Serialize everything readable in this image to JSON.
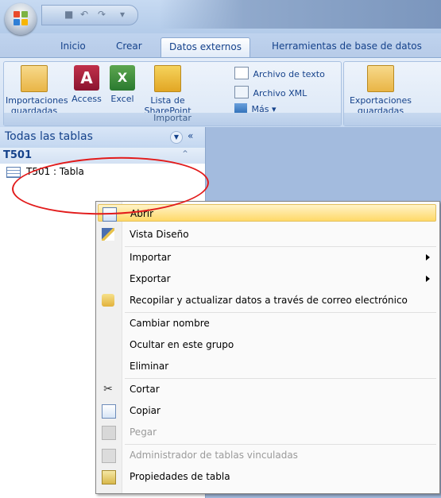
{
  "tabs": [
    {
      "label": "Inicio"
    },
    {
      "label": "Crear"
    },
    {
      "label": "Datos externos"
    },
    {
      "label": "Herramientas de base de datos"
    }
  ],
  "ribbon": {
    "import_group": {
      "caption": "Importar",
      "saved_imports": "Importaciones guardadas",
      "access": "Access",
      "excel": "Excel",
      "sharepoint": "Lista de SharePoint",
      "text_file": "Archivo de texto",
      "xml_file": "Archivo XML",
      "more": "Más"
    },
    "export_group": {
      "saved_exports": "Exportaciones guardadas"
    }
  },
  "nav": {
    "title": "Todas las tablas",
    "collapse": "«",
    "group": "T501",
    "item": "T501 : Tabla"
  },
  "menu": {
    "items": [
      {
        "label": "Abrir"
      },
      {
        "label": "Vista Diseño"
      },
      {
        "label": "Importar"
      },
      {
        "label": "Exportar"
      },
      {
        "label": "Recopilar y actualizar datos a través de correo electrónico"
      },
      {
        "label": "Cambiar nombre"
      },
      {
        "label": "Ocultar en este grupo"
      },
      {
        "label": "Eliminar"
      },
      {
        "label": "Cortar"
      },
      {
        "label": "Copiar"
      },
      {
        "label": "Pegar"
      },
      {
        "label": "Administrador de tablas vinculadas"
      },
      {
        "label": "Propiedades de tabla"
      }
    ]
  },
  "colors": {
    "accent": "#15428b",
    "highlight": "#ffd968",
    "annotation": "#e21b1b"
  }
}
